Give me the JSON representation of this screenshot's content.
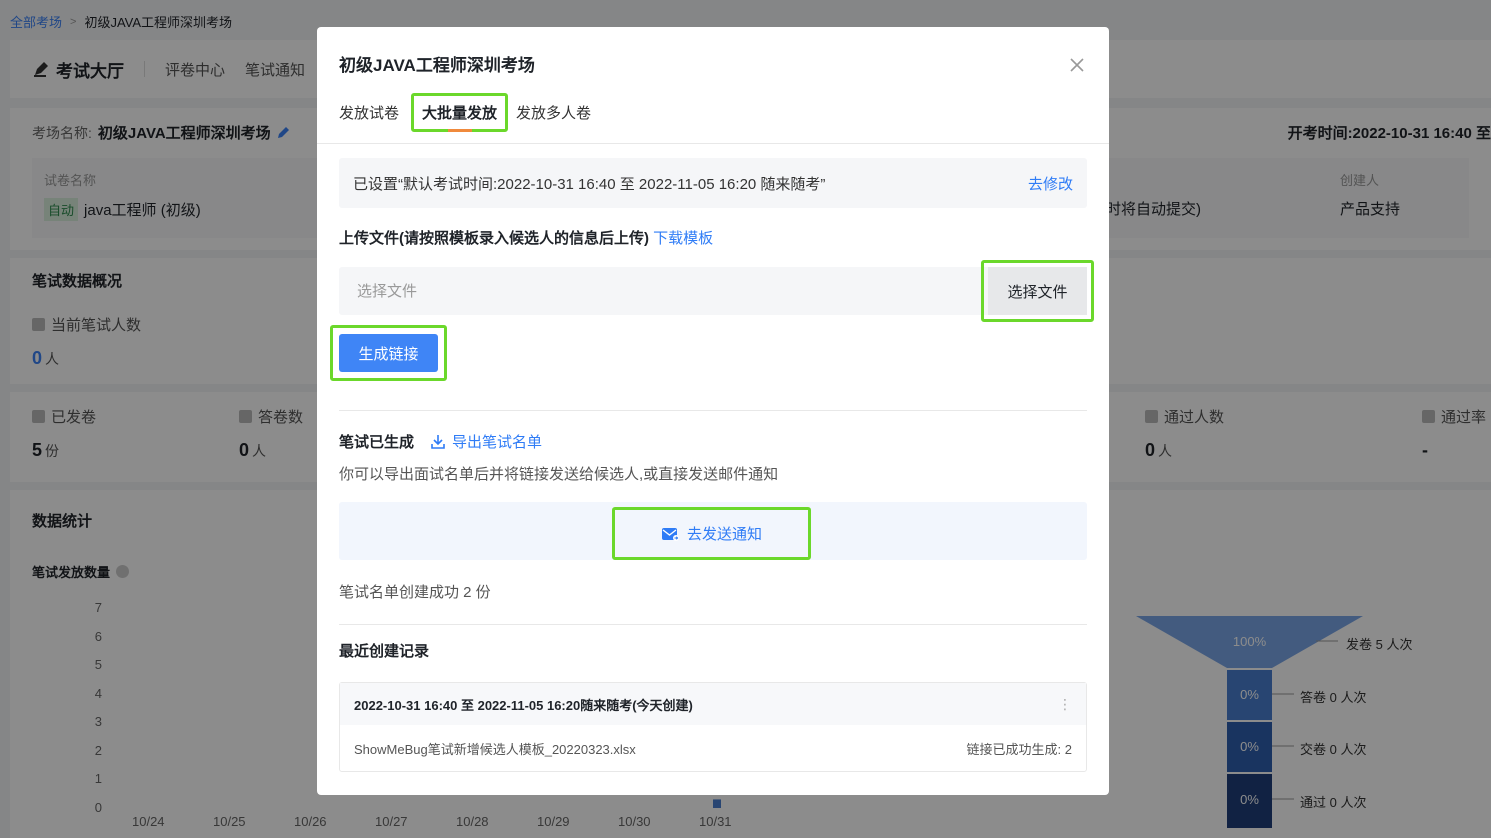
{
  "breadcrumb": {
    "root": "全部考场",
    "current": "初级JAVA工程师深圳考场"
  },
  "topnav": {
    "brand": "考试大厅",
    "tabs": [
      "评卷中心",
      "笔试通知"
    ]
  },
  "info": {
    "name_label": "考场名称:",
    "name": "初级JAVA工程师深圳考场",
    "open_time": "开考时间:2022-10-31 16:40 至",
    "paper_label": "试卷名称",
    "paper_tag": "自动",
    "paper_name": "java工程师 (初级)",
    "auto_submit": "时将自动提交)",
    "creator_label": "创建人",
    "creator": "产品支持"
  },
  "overview": {
    "title": "笔试数据概况",
    "current_label": "当前笔试人数",
    "current_value": "0",
    "unit_person": "人",
    "unit_copy": "份",
    "sent_label": "已发卷",
    "sent_value": "5",
    "answered_label": "答卷数",
    "answered_value": "0",
    "passed_label": "通过人数",
    "passed_value": "0",
    "rate_label": "通过率",
    "rate_value": "-"
  },
  "data_stats": {
    "title": "数据统计",
    "chart_title": "笔试发放数量"
  },
  "chart_data": {
    "type": "bar",
    "title": "笔试发放数量",
    "categories": [
      "10/24",
      "10/25",
      "10/26",
      "10/27",
      "10/28",
      "10/29",
      "10/30",
      "10/31"
    ],
    "values": [
      0,
      0,
      0,
      0,
      0,
      0,
      0,
      0.3
    ],
    "yticks": [
      "7",
      "6",
      "5",
      "4",
      "3",
      "2",
      "1",
      "0"
    ],
    "ylim": [
      0,
      7
    ]
  },
  "funnel": {
    "stages": [
      {
        "pct": "100%",
        "label": "发卷 5 人次"
      },
      {
        "pct": "0%",
        "label": "答卷 0 人次"
      },
      {
        "pct": "0%",
        "label": "交卷 0 人次"
      },
      {
        "pct": "0%",
        "label": "通过 0 人次"
      }
    ]
  },
  "modal": {
    "title": "初级JAVA工程师深圳考场",
    "tabs": [
      "发放试卷",
      "大批量发放",
      "发放多人卷"
    ],
    "notice": "已设置“默认考试时间:2022-10-31 16:40 至 2022-11-05 16:20 随来随考”",
    "notice_link": "去修改",
    "upload_title": "上传文件(请按照模板录入候选人的信息后上传)",
    "download_template": "下载模板",
    "file_placeholder": "选择文件",
    "choose_file": "选择文件",
    "generate_link": "生成链接",
    "generated_title": "笔试已生成",
    "export_list": "导出笔试名单",
    "generated_desc": "你可以导出面试名单后并将链接发送给候选人,或直接发送邮件通知",
    "send_notice": "去发送通知",
    "success_text": "笔试名单创建成功 2 份",
    "recent_title": "最近创建记录",
    "record": {
      "header": "2022-10-31 16:40 至 2022-11-05 16:20随来随考(今天创建)",
      "more": "⋮",
      "file_name": "ShowMeBug笔试新增候选人模板_20220323.xlsx",
      "status": "链接已成功生成: 2"
    }
  }
}
